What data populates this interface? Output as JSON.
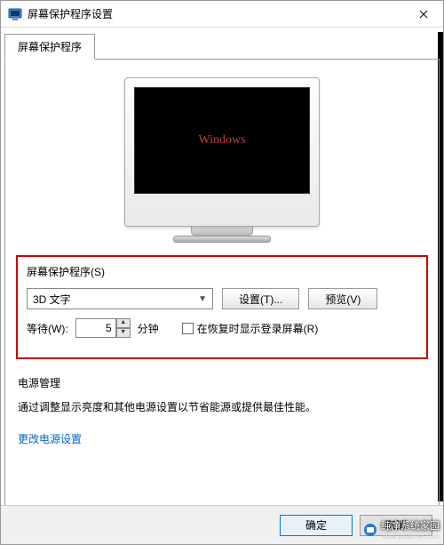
{
  "window": {
    "title": "屏幕保护程序设置"
  },
  "tab": {
    "label": "屏幕保护程序"
  },
  "preview": {
    "screen_text": "Windows"
  },
  "saver": {
    "group_label": "屏幕保护程序(S)",
    "dropdown_value": "3D 文字",
    "settings_btn": "设置(T)...",
    "preview_btn": "预览(V)",
    "wait_label": "等待(W):",
    "wait_value": "5",
    "wait_unit": "分钟",
    "resume_checkbox_label": "在恢复时显示登录屏幕(R)"
  },
  "power": {
    "title": "电源管理",
    "desc": "通过调整显示亮度和其他电源设置以节省能源或提供最佳性能。",
    "link": "更改电源设置"
  },
  "buttons": {
    "ok": "确定",
    "cancel": "取消"
  },
  "watermark": {
    "text": "纯净系统家园",
    "url": "www.yidaimei.com"
  }
}
